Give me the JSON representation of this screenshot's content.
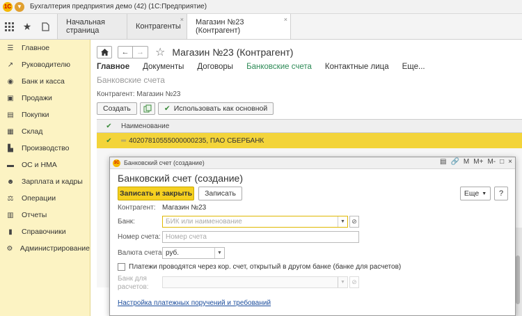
{
  "window": {
    "title": "Бухгалтерия предприятия демо (42)  (1С:Предприятие)"
  },
  "tabs": [
    {
      "label": "Начальная страница"
    },
    {
      "label": "Контрагенты"
    },
    {
      "label": "Магазин №23 (Контрагент)"
    }
  ],
  "sidebar": {
    "items": [
      {
        "label": "Главное",
        "icon": "menu-icon"
      },
      {
        "label": "Руководителю",
        "icon": "chart-icon"
      },
      {
        "label": "Банк и касса",
        "icon": "bank-icon"
      },
      {
        "label": "Продажи",
        "icon": "cart-icon"
      },
      {
        "label": "Покупки",
        "icon": "basket-icon"
      },
      {
        "label": "Склад",
        "icon": "warehouse-icon"
      },
      {
        "label": "Производство",
        "icon": "factory-icon"
      },
      {
        "label": "ОС и НМА",
        "icon": "truck-icon"
      },
      {
        "label": "Зарплата и кадры",
        "icon": "people-icon"
      },
      {
        "label": "Операции",
        "icon": "scales-icon"
      },
      {
        "label": "Отчеты",
        "icon": "report-icon"
      },
      {
        "label": "Справочники",
        "icon": "book-icon"
      },
      {
        "label": "Администрирование",
        "icon": "gear-icon"
      }
    ]
  },
  "main": {
    "title": "Магазин №23 (Контрагент)",
    "subnav": [
      "Главное",
      "Документы",
      "Договоры",
      "Банковские счета",
      "Контактные лица",
      "Еще..."
    ],
    "section_title": "Банковские счета",
    "kontragent_label": "Контрагент:",
    "kontragent_value": "Магазин №23",
    "create_label": "Создать",
    "use_main_label": "Использовать как основной",
    "grid_header": "Наименование",
    "grid_row": "40207810555000000235, ПАО СБЕРБАНК"
  },
  "dialog": {
    "window_title": "Банковский счет (создание)",
    "heading": "Банковский счет (создание)",
    "save_close_label": "Записать и закрыть",
    "save_label": "Записать",
    "more_label": "Еще",
    "help_label": "?",
    "kontragent_label": "Контрагент:",
    "kontragent_value": "Магазин №23",
    "bank_label": "Банк:",
    "bank_placeholder": "БИК или наименование",
    "account_label": "Номер счета:",
    "account_placeholder": "Номер счета",
    "currency_label": "Валюта счета:",
    "currency_value": "руб.",
    "checkbox_label": "Платежи проводятся через кор. счет, открытый в другом банке (банке для расчетов)",
    "settlement_bank_label_1": "Банк для",
    "settlement_bank_label_2": "расчетов:",
    "settings_link": "Настройка платежных поручений и требований"
  }
}
